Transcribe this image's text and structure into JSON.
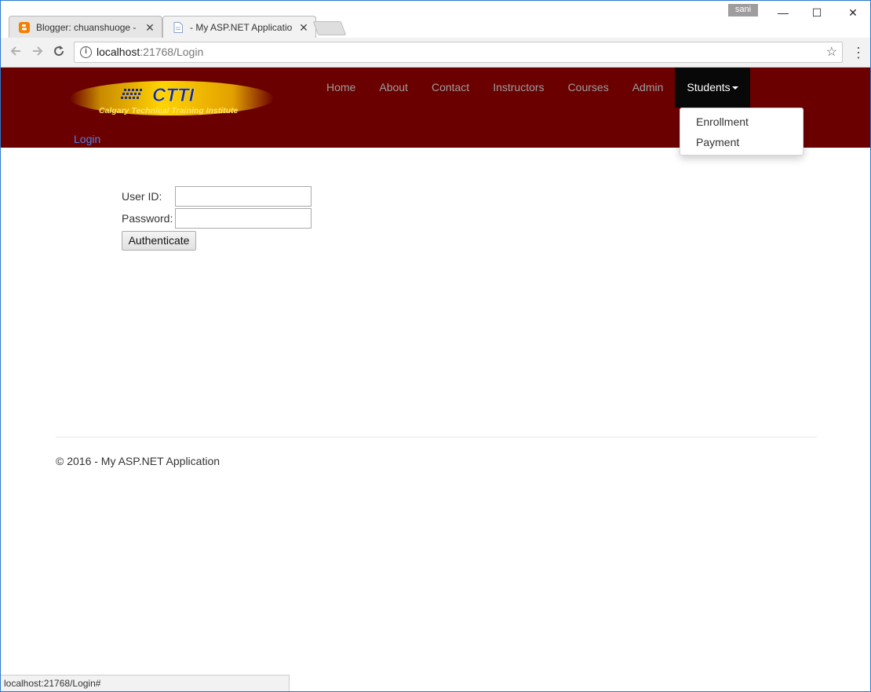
{
  "browser": {
    "tabs": [
      {
        "title": "Blogger: chuanshuoge - ",
        "close": "✕"
      },
      {
        "title": "- My ASP.NET Applicatio",
        "close": "✕"
      }
    ],
    "profile_name": "sani",
    "window_controls": {
      "minimize": "—",
      "maximize": "☐",
      "close": "✕"
    },
    "address": {
      "host": "localhost",
      "path": ":21768/Login"
    },
    "status_url": "localhost:21768/Login#",
    "icons": {
      "back": "back-arrow-icon",
      "forward": "forward-arrow-icon",
      "reload": "reload-icon",
      "info": "info-icon",
      "star": "bookmark-star-icon",
      "menu": "menu-dots-icon"
    }
  },
  "site": {
    "logo_text": "CTTI",
    "logo_subtitle": "Calgary Technical Training Institute",
    "nav": [
      "Home",
      "About",
      "Contact",
      "Instructors",
      "Courses",
      "Admin"
    ],
    "nav_active": "Students",
    "login_link": "Login",
    "dropdown": [
      "Enrollment",
      "Payment"
    ],
    "colors": {
      "navbar": "#6b0000",
      "active": "#080808",
      "link": "#4f7fe6"
    }
  },
  "form": {
    "user_label": "User ID:",
    "user_value": "",
    "password_label": "Password:",
    "password_value": "",
    "submit": "Authenticate"
  },
  "footer": {
    "text": "© 2016 - My ASP.NET Application"
  }
}
